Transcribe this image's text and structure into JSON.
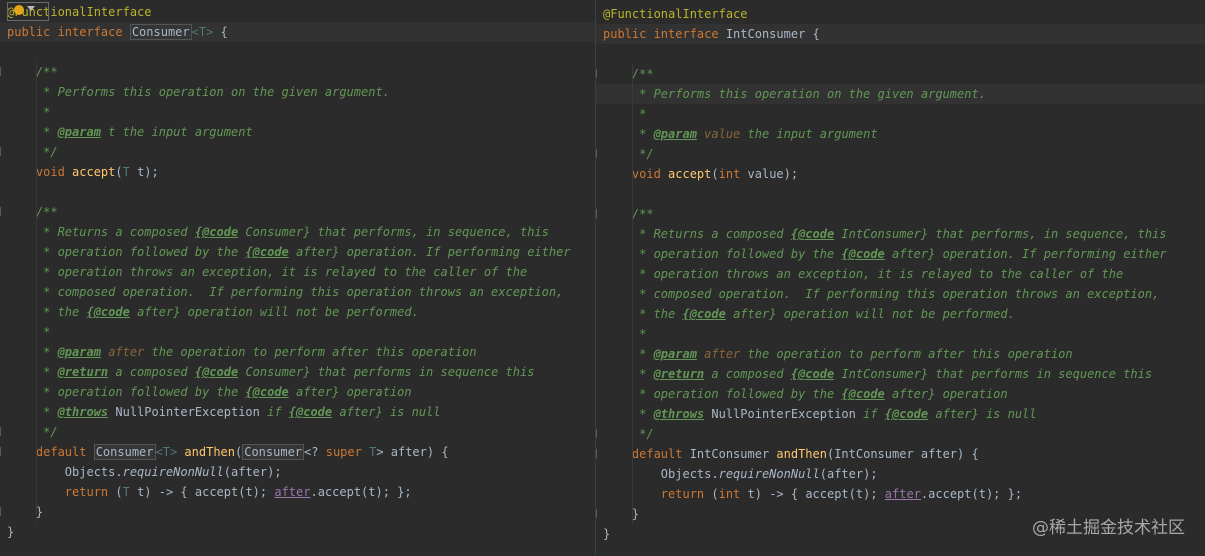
{
  "left": {
    "lines": [
      [
        [
          "ann",
          "@FunctionalInterface"
        ]
      ],
      [
        [
          "kw",
          "public "
        ],
        [
          "kw",
          "interface "
        ],
        [
          "refbox",
          "Consumer"
        ],
        [
          "tp",
          "<T>"
        ],
        [
          "",
          " {"
        ]
      ],
      [],
      [
        [
          "doc",
          "    /**"
        ]
      ],
      [
        [
          "doc",
          "     * Performs this operation on the given argument."
        ]
      ],
      [
        [
          "doc",
          "     *"
        ]
      ],
      [
        [
          "doc",
          "     * "
        ],
        [
          "tag",
          "@param"
        ],
        [
          "doc",
          " t the input argument"
        ]
      ],
      [
        [
          "doc",
          "     */"
        ]
      ],
      [
        [
          "kw",
          "    void "
        ],
        [
          "meth",
          "accept"
        ],
        [
          "",
          "("
        ],
        [
          "tp",
          "T"
        ],
        [
          "",
          " t);"
        ]
      ],
      [],
      [
        [
          "doc",
          "    /**"
        ]
      ],
      [
        [
          "doc",
          "     * Returns a composed "
        ],
        [
          "tag",
          "{@code"
        ],
        [
          "doc",
          " Consumer} that performs, in sequence, this"
        ]
      ],
      [
        [
          "doc",
          "     * operation followed by the "
        ],
        [
          "tag",
          "{@code"
        ],
        [
          "doc",
          " after} operation. If performing either"
        ]
      ],
      [
        [
          "doc",
          "     * operation throws an exception, it is relayed to the caller of the"
        ]
      ],
      [
        [
          "doc",
          "     * composed operation.  If performing this operation throws an exception,"
        ]
      ],
      [
        [
          "doc",
          "     * the "
        ],
        [
          "tag",
          "{@code"
        ],
        [
          "doc",
          " after} operation will not be performed."
        ]
      ],
      [
        [
          "doc",
          "     *"
        ]
      ],
      [
        [
          "doc",
          "     * "
        ],
        [
          "tag",
          "@param"
        ],
        [
          "param",
          " after"
        ],
        [
          "doc",
          " the operation to perform after this operation"
        ]
      ],
      [
        [
          "doc",
          "     * "
        ],
        [
          "tag",
          "@return"
        ],
        [
          "doc",
          " a composed "
        ],
        [
          "tag",
          "{@code"
        ],
        [
          "doc",
          " Consumer} that performs in sequence this"
        ]
      ],
      [
        [
          "doc",
          "     * operation followed by the "
        ],
        [
          "tag",
          "{@code"
        ],
        [
          "doc",
          " after} operation"
        ]
      ],
      [
        [
          "doc",
          "     * "
        ],
        [
          "tag",
          "@throws"
        ],
        [
          "",
          " NullPointerException"
        ],
        [
          "doc",
          " if "
        ],
        [
          "tag",
          "{@code"
        ],
        [
          "doc",
          " after} is null"
        ]
      ],
      [
        [
          "doc",
          "     */"
        ]
      ],
      [
        [
          "kw",
          "    default "
        ],
        [
          "refbox",
          "Consumer"
        ],
        [
          "tp",
          "<T>"
        ],
        [
          "",
          " "
        ],
        [
          "meth",
          "andThen"
        ],
        [
          "",
          "("
        ],
        [
          "refbox",
          "Consumer"
        ],
        [
          "",
          "<? "
        ],
        [
          "kw",
          "super "
        ],
        [
          "tp",
          "T"
        ],
        [
          "",
          "> after) {"
        ]
      ],
      [
        [
          "",
          "        Objects."
        ],
        [
          "static",
          "requireNonNull"
        ],
        [
          "",
          "(after);"
        ]
      ],
      [
        [
          "kw",
          "        return "
        ],
        [
          "",
          "("
        ],
        [
          "tp",
          "T"
        ],
        [
          "",
          " t) -> { accept(t); "
        ],
        [
          "field",
          "after"
        ],
        [
          "",
          ".accept(t); };"
        ]
      ],
      [
        [
          "",
          "    }"
        ]
      ],
      [
        [
          "",
          "}"
        ]
      ]
    ]
  },
  "right": {
    "lines": [
      [
        [
          "ann",
          "@FunctionalInterface"
        ]
      ],
      [
        [
          "kw",
          "public "
        ],
        [
          "kw",
          "interface "
        ],
        [
          "",
          "IntConsumer {"
        ]
      ],
      [],
      [
        [
          "doc",
          "    /**"
        ]
      ],
      [
        [
          "doc",
          "     * Performs this operation on the given argument."
        ]
      ],
      [
        [
          "doc",
          "     *"
        ]
      ],
      [
        [
          "doc",
          "     * "
        ],
        [
          "tag",
          "@param"
        ],
        [
          "param",
          " value"
        ],
        [
          "doc",
          " the input argument"
        ]
      ],
      [
        [
          "doc",
          "     */"
        ]
      ],
      [
        [
          "kw",
          "    void "
        ],
        [
          "meth",
          "accept"
        ],
        [
          "",
          "("
        ],
        [
          "kw",
          "int "
        ],
        [
          "",
          "value);"
        ]
      ],
      [],
      [
        [
          "doc",
          "    /**"
        ]
      ],
      [
        [
          "doc",
          "     * Returns a composed "
        ],
        [
          "tag",
          "{@code"
        ],
        [
          "doc",
          " IntConsumer} that performs, in sequence, this"
        ]
      ],
      [
        [
          "doc",
          "     * operation followed by the "
        ],
        [
          "tag",
          "{@code"
        ],
        [
          "doc",
          " after} operation. If performing either"
        ]
      ],
      [
        [
          "doc",
          "     * operation throws an exception, it is relayed to the caller of the"
        ]
      ],
      [
        [
          "doc",
          "     * composed operation.  If performing this operation throws an exception,"
        ]
      ],
      [
        [
          "doc",
          "     * the "
        ],
        [
          "tag",
          "{@code"
        ],
        [
          "doc",
          " after} operation will not be performed."
        ]
      ],
      [
        [
          "doc",
          "     *"
        ]
      ],
      [
        [
          "doc",
          "     * "
        ],
        [
          "tag",
          "@param"
        ],
        [
          "param",
          " after"
        ],
        [
          "doc",
          " the operation to perform after this operation"
        ]
      ],
      [
        [
          "doc",
          "     * "
        ],
        [
          "tag",
          "@return"
        ],
        [
          "doc",
          " a composed "
        ],
        [
          "tag",
          "{@code"
        ],
        [
          "doc",
          " IntConsumer} that performs in sequence this"
        ]
      ],
      [
        [
          "doc",
          "     * operation followed by the "
        ],
        [
          "tag",
          "{@code"
        ],
        [
          "doc",
          " after} operation"
        ]
      ],
      [
        [
          "doc",
          "     * "
        ],
        [
          "tag",
          "@throws"
        ],
        [
          "",
          " NullPointerException"
        ],
        [
          "doc",
          " if "
        ],
        [
          "tag",
          "{@code"
        ],
        [
          "doc",
          " after} is null"
        ]
      ],
      [
        [
          "doc",
          "     */"
        ]
      ],
      [
        [
          "kw",
          "    default "
        ],
        [
          "",
          "IntConsumer "
        ],
        [
          "meth",
          "andThen"
        ],
        [
          "",
          "(IntConsumer after) {"
        ]
      ],
      [
        [
          "",
          "        Objects."
        ],
        [
          "static",
          "requireNonNull"
        ],
        [
          "",
          "(after);"
        ]
      ],
      [
        [
          "kw",
          "        return "
        ],
        [
          "",
          "("
        ],
        [
          "kw",
          "int "
        ],
        [
          "",
          "t) -> { accept(t); "
        ],
        [
          "field",
          "after"
        ],
        [
          "",
          ".accept(t); };"
        ]
      ],
      [
        [
          "",
          "    }"
        ]
      ],
      [
        [
          "",
          "}"
        ]
      ]
    ]
  },
  "watermark": "@稀土掘金技术社区"
}
